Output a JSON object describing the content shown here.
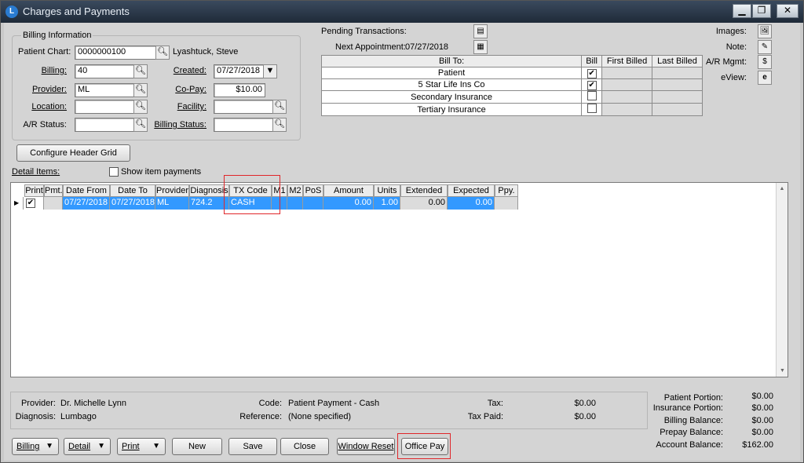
{
  "window": {
    "title": "Charges and Payments",
    "controls": [
      "▁",
      "❐",
      "✕"
    ]
  },
  "billing_info": {
    "group_title": "Billing Information",
    "patient_chart_label": "Patient Chart:",
    "patient_chart_value": "0000000100",
    "patient_name": "Lyashtuck, Steve",
    "billing_label": "Billing:",
    "billing_value": "40",
    "created_label": "Created:",
    "created_value": "07/27/2018",
    "provider_label": "Provider:",
    "provider_value": "ML",
    "copay_label": "Co-Pay:",
    "copay_value": "$10.00",
    "location_label": "Location:",
    "location_value": "",
    "facility_label": "Facility:",
    "facility_value": "",
    "ar_status_label": "A/R Status:",
    "ar_status_value": "",
    "billing_status_label": "Billing Status:",
    "billing_status_value": ""
  },
  "pending": {
    "pending_label": "Pending Transactions:",
    "next_appt_label": "Next Appointment:",
    "next_appt_value": "07/27/2018"
  },
  "bill_to": {
    "headers": [
      "Bill To:",
      "Bill",
      "First Billed",
      "Last Billed"
    ],
    "rows": [
      {
        "name": "Patient",
        "bill": true
      },
      {
        "name": "5 Star Life Ins Co",
        "bill": true
      },
      {
        "name": "Secondary Insurance",
        "bill": false
      },
      {
        "name": "Tertiary Insurance",
        "bill": false
      }
    ]
  },
  "right_links": {
    "images": "Images:",
    "note": "Note:",
    "ar_mgmt": "A/R Mgmt:",
    "eview": "eView:"
  },
  "configure_button": "Configure Header Grid",
  "detail": {
    "label": "Detail Items:",
    "show_payments": "Show item payments",
    "columns": [
      "Print",
      "Pmt.",
      "Date From",
      "Date To",
      "Provider",
      "Diagnosis",
      "TX Code",
      "M1",
      "M2",
      "PoS",
      "Amount",
      "Units",
      "Extended",
      "Expected",
      "Ppy."
    ],
    "row": {
      "date_from": "07/27/2018",
      "date_to": "07/27/2018",
      "provider": "ML",
      "diagnosis": "724.2",
      "tx_code": "CASH",
      "amount": "0.00",
      "units": "1.00",
      "extended": "0.00",
      "expected": "0.00"
    }
  },
  "summary": {
    "provider_label": "Provider:",
    "provider_value": "Dr. Michelle Lynn",
    "diagnosis_label": "Diagnosis:",
    "diagnosis_value": "Lumbago",
    "code_label": "Code:",
    "code_value": "Patient Payment - Cash",
    "reference_label": "Reference:",
    "reference_value": "(None specified)",
    "tax_label": "Tax:",
    "tax_value": "$0.00",
    "tax_paid_label": "Tax Paid:",
    "tax_paid_value": "$0.00"
  },
  "balances": {
    "patient_portion_label": "Patient Portion:",
    "patient_portion": "$0.00",
    "insurance_portion_label": "Insurance Portion:",
    "insurance_portion": "$0.00",
    "billing_balance_label": "Billing Balance:",
    "billing_balance": "$0.00",
    "prepay_balance_label": "Prepay Balance:",
    "prepay_balance": "$0.00",
    "account_balance_label": "Account Balance:",
    "account_balance": "$162.00"
  },
  "buttons": {
    "billing": "Billing",
    "detail": "Detail",
    "print": "Print",
    "new": "New",
    "save": "Save",
    "close": "Close",
    "window_reset": "Window Reset",
    "office_pay": "Office Pay"
  }
}
